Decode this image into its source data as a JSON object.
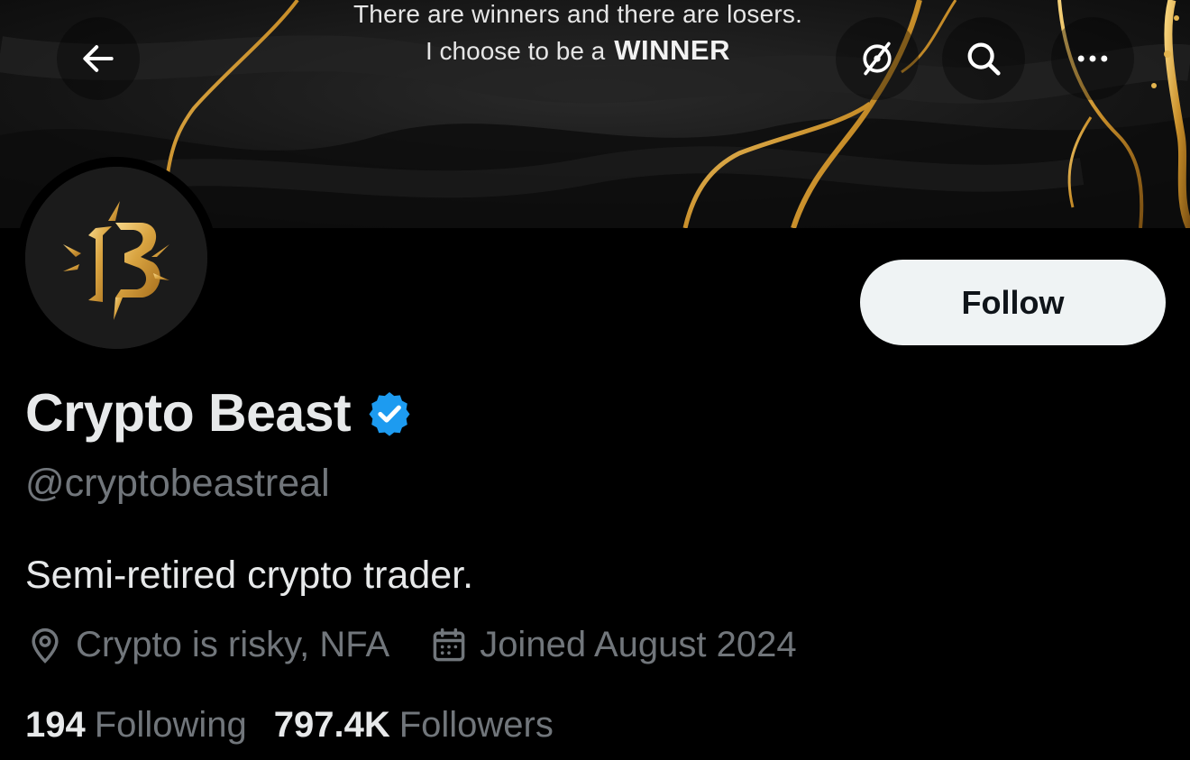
{
  "banner": {
    "quote_line1": "There are winners and there are losers.",
    "quote_line2": "I choose to be a",
    "quote_emphasis": "WINNER"
  },
  "header_icons": {
    "back": "arrow-left-icon",
    "rss": "broadcast-off-icon",
    "search": "search-icon",
    "more": "more-dots-icon"
  },
  "profile": {
    "display_name": "Crypto Beast",
    "handle": "@cryptobeastreal",
    "bio": "Semi-retired crypto trader.",
    "location": "Crypto is risky, NFA",
    "joined": "Joined August 2024",
    "verified": true
  },
  "follow_button": {
    "label": "Follow"
  },
  "stats": {
    "following_count": "194",
    "following_label": "Following",
    "followers_count": "797.4K",
    "followers_label": "Followers"
  },
  "colors": {
    "background": "#000000",
    "primary_text": "#e7e9ea",
    "secondary_text": "#71767b",
    "verified_blue": "#1d9bf0",
    "follow_button_bg": "#eff3f4",
    "gold": "#d9a441"
  }
}
